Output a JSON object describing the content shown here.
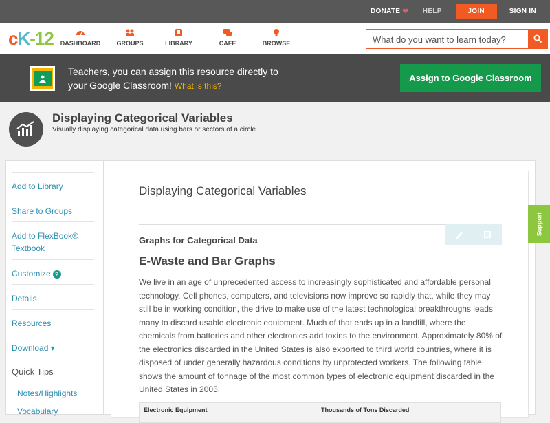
{
  "topbar": {
    "donate": "DONATE",
    "help": "HELP",
    "join": "JOIN",
    "signin": "SIGN IN"
  },
  "nav": {
    "logo": {
      "c": "c",
      "k": "K",
      "n": "-12"
    },
    "items": [
      {
        "label": "DASHBOARD",
        "icon": "dashboard-icon"
      },
      {
        "label": "GROUPS",
        "icon": "groups-icon"
      },
      {
        "label": "LIBRARY",
        "icon": "library-icon"
      },
      {
        "label": "CAFE",
        "icon": "cafe-icon"
      },
      {
        "label": "BROWSE",
        "icon": "browse-icon"
      }
    ],
    "search_placeholder": "What do you want to learn today?"
  },
  "banner": {
    "line1": "Teachers, you can assign this resource directly to",
    "line2": "your Google Classroom!",
    "what": "What is this?",
    "assign_button": "Assign to Google Classroom"
  },
  "title": {
    "main": "Displaying Categorical Variables",
    "sub": "Visually displaying categorical data using bars or sectors of a circle"
  },
  "sidebar": {
    "items": [
      "Add to Library",
      "Share to Groups",
      "Add to FlexBook® Textbook",
      "Customize",
      "Details",
      "Resources",
      "Download ▾"
    ],
    "quick_tips": "Quick Tips",
    "tips": [
      "Notes/Highlights",
      "Vocabulary"
    ],
    "customize_badge": "?"
  },
  "content": {
    "title": "Displaying Categorical Variables",
    "section": "Graphs for Categorical Data",
    "heading": "E-Waste and Bar Graphs",
    "paragraph": "We live in an age of unprecedented access to increasingly sophisticated and affordable personal technology. Cell phones, computers, and televisions now improve so rapidly that, while they may still be in working condition, the drive to make use of the latest technological breakthroughs leads many to discard usable electronic equipment. Much of that ends up in a landfill, where the chemicals from batteries and other electronics add toxins to the environment. Approximately 80% of the electronics discarded in the United States is also exported to third world countries, where it is disposed of under generally hazardous conditions by unprotected workers. The following table shows the amount of tonnage of the most common types of electronic equipment discarded in the United States in 2005.",
    "table_headers": [
      "Electronic Equipment",
      "Thousands of Tons Discarded"
    ]
  },
  "support": "Support",
  "colors": {
    "accent": "#f15a22",
    "green": "#159a4c",
    "link": "#2b8fb2",
    "support": "#8dc63f"
  }
}
